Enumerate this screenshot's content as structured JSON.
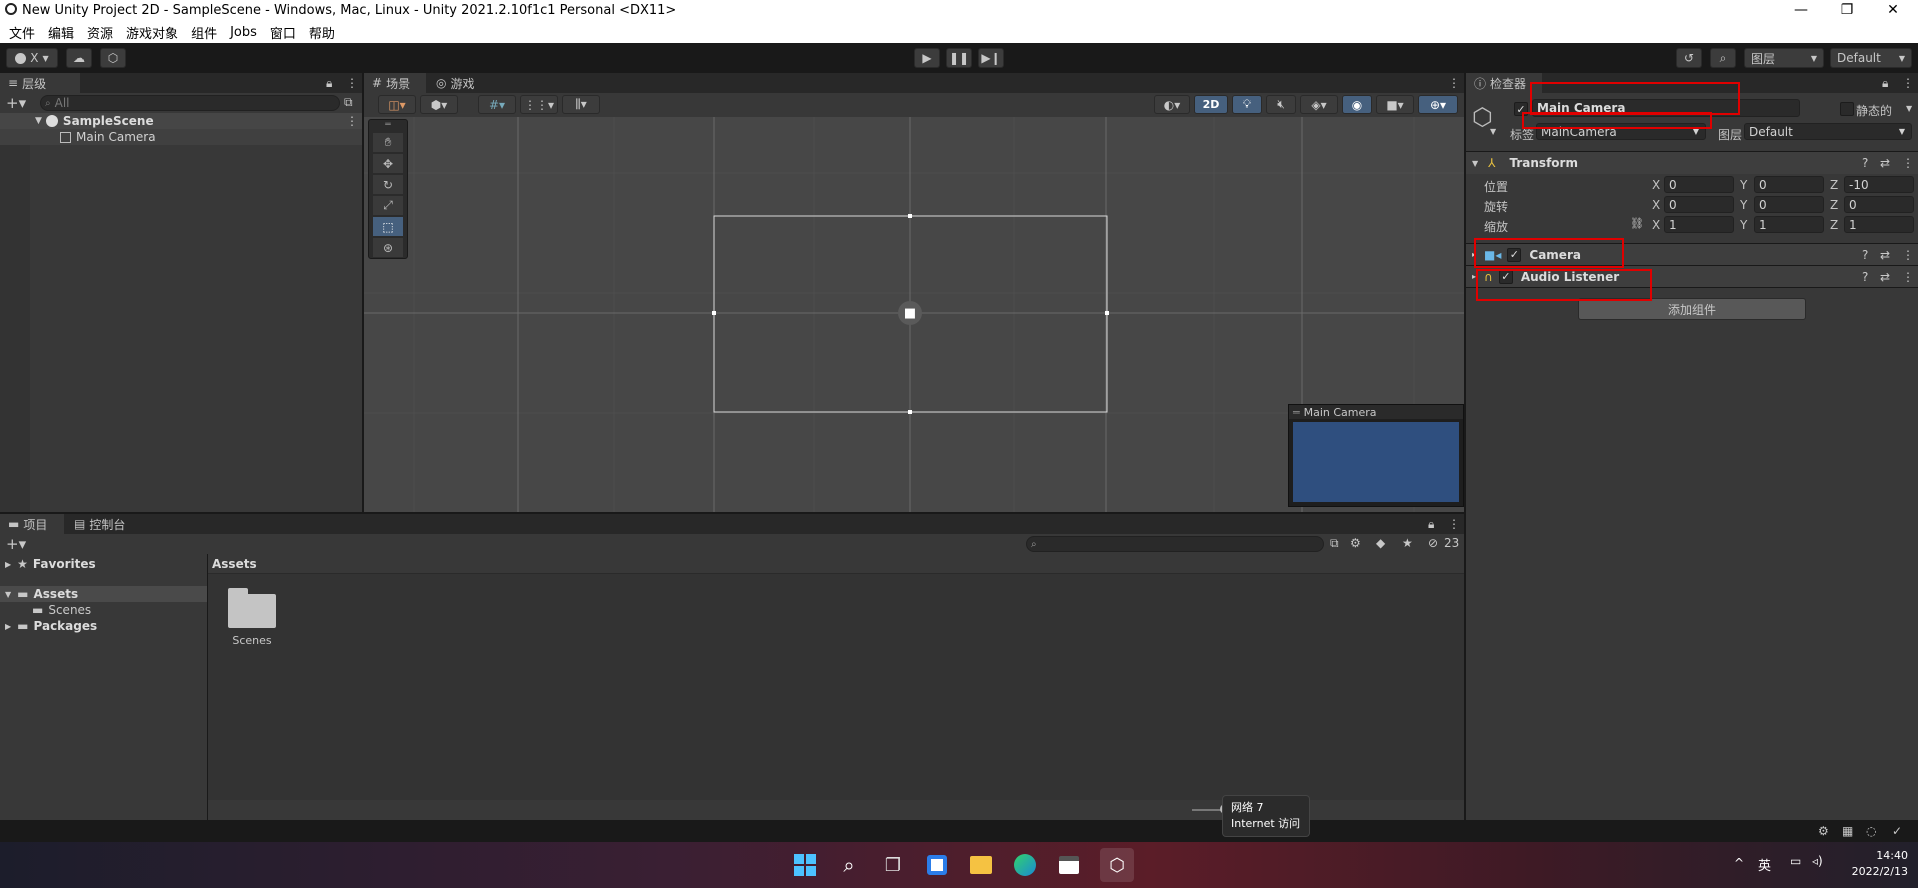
{
  "window": {
    "title": "New Unity Project 2D - SampleScene - Windows, Mac, Linux - Unity 2021.2.10f1c1 Personal <DX11>",
    "controls": [
      "—",
      "❐",
      "✕"
    ]
  },
  "menu": [
    "文件",
    "编辑",
    "资源",
    "游戏对象",
    "组件",
    "Jobs",
    "窗口",
    "帮助"
  ],
  "toolbar": {
    "account_label": "X",
    "layers_label": "图层",
    "layout_label": "Default"
  },
  "hierarchy": {
    "tab_label": "层级",
    "search_placeholder": "All",
    "scene_name": "SampleScene",
    "items": [
      "Main Camera"
    ]
  },
  "scene": {
    "tabs": [
      "场景",
      "游戏"
    ],
    "mode_2d_label": "2D",
    "camera_preview_title": "Main Camera",
    "camera_preview_color": "#2f4f7f"
  },
  "inspector": {
    "tab_label": "检查器",
    "object_name": "Main Camera",
    "static_label": "静态的",
    "tag_label": "标签",
    "tag_value": "MainCamera",
    "layer_label": "图层",
    "layer_value": "Default",
    "transform": {
      "title": "Transform",
      "position_label": "位置",
      "rotation_label": "旋转",
      "scale_label": "缩放",
      "axis_x": "X",
      "axis_y": "Y",
      "axis_z": "Z",
      "position": [
        "0",
        "0",
        "-10"
      ],
      "rotation": [
        "0",
        "0",
        "0"
      ],
      "scale": [
        "1",
        "1",
        "1"
      ]
    },
    "components": [
      "Camera",
      "Audio Listener"
    ],
    "add_component_label": "添加组件"
  },
  "project": {
    "tabs": [
      "项目",
      "控制台"
    ],
    "favorites_label": "Favorites",
    "assets_label": "Assets",
    "scenes_label": "Scenes",
    "packages_label": "Packages",
    "breadcrumb": "Assets",
    "assets": [
      {
        "name": "Scenes",
        "icon": "folder-icon"
      }
    ],
    "hidden_count": "23"
  },
  "tooltip": {
    "line1": "网络 7",
    "line2": "Internet 访问"
  },
  "taskbar": {
    "ime_label": "英",
    "time": "14:40",
    "date": "2022/2/13"
  },
  "colors": {
    "accent": "#3d6f9e",
    "highlight_box": "#e00000",
    "panel": "#383838",
    "scene_bg": "#474747"
  }
}
